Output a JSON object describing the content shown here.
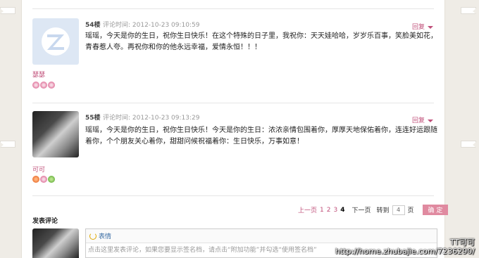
{
  "comments": [
    {
      "floor": "54楼",
      "meta": "评论时间: 2012-10-23 09:10:59",
      "reply": "回复",
      "content": "瑶瑶，今天是你的生日，祝你生日快乐！在这个特殊的日子里，我祝你：天天娃哈哈，岁岁乐百事，笑脸美如花，青春惹人夸。再祝你和你的他永远幸福，爱情永恒！！！",
      "signature": "瑟瑟",
      "avatar": "default-avatar-icon",
      "emoticons": [
        "flower",
        "flower",
        "flower"
      ]
    },
    {
      "floor": "55楼",
      "meta": "评论时间: 2012-10-23 09:13:29",
      "reply": "回复",
      "content": "瑶瑶，今天是你的生日，祝你生日快乐！今天是你的生日：浓浓亲情包围着你，厚厚天地保佑着你，连连好运跟随着你，个个朋友关心着你，甜甜问候祝福着你：生日快乐，万事如意！",
      "signature": "可可",
      "avatar": "photo-avatar",
      "emoticons": [
        "orange",
        "flower",
        "leaf"
      ]
    }
  ],
  "pagination": {
    "prev": "上一页",
    "pages": [
      "1",
      "2",
      "3"
    ],
    "current": "4",
    "next": "下一页",
    "goto_label": "转到",
    "page_input": "4",
    "page_unit": "页",
    "confirm": "确 定"
  },
  "compose": {
    "title": "发表评论",
    "emoticon_label": "表情",
    "hint": "点击这里发表评论，如果您要显示签名档，请点击“附加功能”并勾选“使用签名档”"
  },
  "watermark": {
    "name": "TT可可",
    "url": "http://home.zhubajie.com/7236290/"
  },
  "colors": {
    "accent": "#c0507a",
    "button": "#e08aa0",
    "background": "#efece6"
  }
}
